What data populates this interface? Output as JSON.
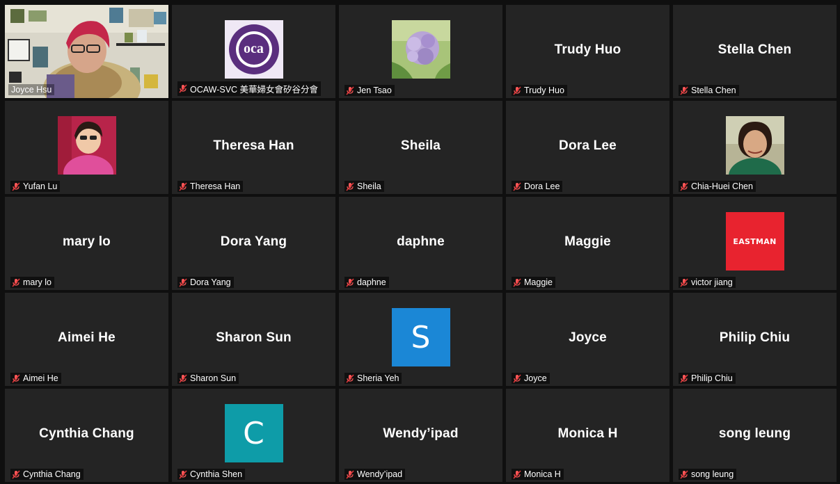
{
  "meeting": {
    "participants": [
      {
        "label": "Joyce Hsu",
        "type": "video",
        "active": true
      },
      {
        "label": "OCAW-SVC 美華婦女會矽谷分會",
        "type": "logo",
        "logo_text": "oca"
      },
      {
        "label": "Jen Tsao",
        "type": "image",
        "image": "hydrangea-painting"
      },
      {
        "label": "Trudy Huo",
        "display": "Trudy Huo",
        "type": "name"
      },
      {
        "label": "Stella Chen",
        "display": "Stella Chen",
        "type": "name"
      },
      {
        "label": "Yufan Lu",
        "type": "image",
        "image": "portrait-photo"
      },
      {
        "label": "Theresa Han",
        "display": "Theresa Han",
        "type": "name"
      },
      {
        "label": "Sheila",
        "display": "Sheila",
        "type": "name"
      },
      {
        "label": "Dora Lee",
        "display": "Dora Lee",
        "type": "name"
      },
      {
        "label": "Chia-Huei Chen",
        "type": "image",
        "image": "portrait-photo"
      },
      {
        "label": "mary lo",
        "display": "mary lo",
        "type": "name"
      },
      {
        "label": "Dora Yang",
        "display": "Dora Yang",
        "type": "name"
      },
      {
        "label": "daphne",
        "display": "daphne",
        "type": "name"
      },
      {
        "label": "Maggie",
        "display": "Maggie",
        "type": "name"
      },
      {
        "label": "victor jiang",
        "type": "logo",
        "logo_text": "EASTMAN",
        "color": "#e8232f"
      },
      {
        "label": "Aimei He",
        "display": "Aimei He",
        "type": "name"
      },
      {
        "label": "Sharon Sun",
        "display": "Sharon Sun",
        "type": "name"
      },
      {
        "label": "Sheria Yeh",
        "type": "letter",
        "letter": "S",
        "color": "#1b87d6"
      },
      {
        "label": "Joyce",
        "display": "Joyce",
        "type": "name"
      },
      {
        "label": "Philip Chiu",
        "display": "Philip Chiu",
        "type": "name"
      },
      {
        "label": "Cynthia Chang",
        "display": "Cynthia Chang",
        "type": "name"
      },
      {
        "label": "Cynthia Shen",
        "type": "letter",
        "letter": "C",
        "color": "#0e9ca8"
      },
      {
        "label": "Wendy’ipad",
        "display": "Wendy’ipad",
        "type": "name"
      },
      {
        "label": "Monica H",
        "display": "Monica H",
        "type": "name"
      },
      {
        "label": "song leung",
        "display": "song leung",
        "type": "name"
      }
    ]
  },
  "colors": {
    "active_speaker_border": "#c8ee4e",
    "muted_mic": "#e0383b",
    "tile_background": "#242424"
  },
  "icons": {
    "mute": "muted-microphone-icon"
  }
}
